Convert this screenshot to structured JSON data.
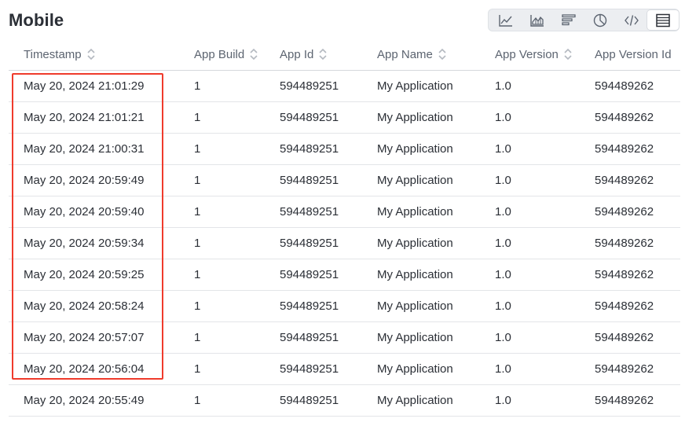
{
  "page": {
    "title": "Mobile"
  },
  "toolbar": {
    "buttons": [
      {
        "icon": "line-chart-icon",
        "active": false
      },
      {
        "icon": "area-chart-icon",
        "active": false
      },
      {
        "icon": "bar-chart-icon",
        "active": false
      },
      {
        "icon": "pie-chart-icon",
        "active": false
      },
      {
        "icon": "code-icon",
        "active": false
      },
      {
        "icon": "table-icon",
        "active": true
      }
    ]
  },
  "table": {
    "columns": [
      "Timestamp",
      "App Build",
      "App Id",
      "App Name",
      "App Version",
      "App Version Id"
    ],
    "rows": [
      [
        "May 20, 2024 21:01:29",
        "1",
        "594489251",
        "My Application",
        "1.0",
        "594489262"
      ],
      [
        "May 20, 2024 21:01:21",
        "1",
        "594489251",
        "My Application",
        "1.0",
        "594489262"
      ],
      [
        "May 20, 2024 21:00:31",
        "1",
        "594489251",
        "My Application",
        "1.0",
        "594489262"
      ],
      [
        "May 20, 2024 20:59:49",
        "1",
        "594489251",
        "My Application",
        "1.0",
        "594489262"
      ],
      [
        "May 20, 2024 20:59:40",
        "1",
        "594489251",
        "My Application",
        "1.0",
        "594489262"
      ],
      [
        "May 20, 2024 20:59:34",
        "1",
        "594489251",
        "My Application",
        "1.0",
        "594489262"
      ],
      [
        "May 20, 2024 20:59:25",
        "1",
        "594489251",
        "My Application",
        "1.0",
        "594489262"
      ],
      [
        "May 20, 2024 20:58:24",
        "1",
        "594489251",
        "My Application",
        "1.0",
        "594489262"
      ],
      [
        "May 20, 2024 20:57:07",
        "1",
        "594489251",
        "My Application",
        "1.0",
        "594489262"
      ],
      [
        "May 20, 2024 20:56:04",
        "1",
        "594489251",
        "My Application",
        "1.0",
        "594489262"
      ],
      [
        "May 20, 2024 20:55:49",
        "1",
        "594489251",
        "My Application",
        "1.0",
        "594489262"
      ]
    ]
  },
  "colors": {
    "highlight": "#ef3b2c",
    "text": "#2b2f36",
    "header_text": "#5c6470",
    "row_border": "#e3e5e8"
  }
}
